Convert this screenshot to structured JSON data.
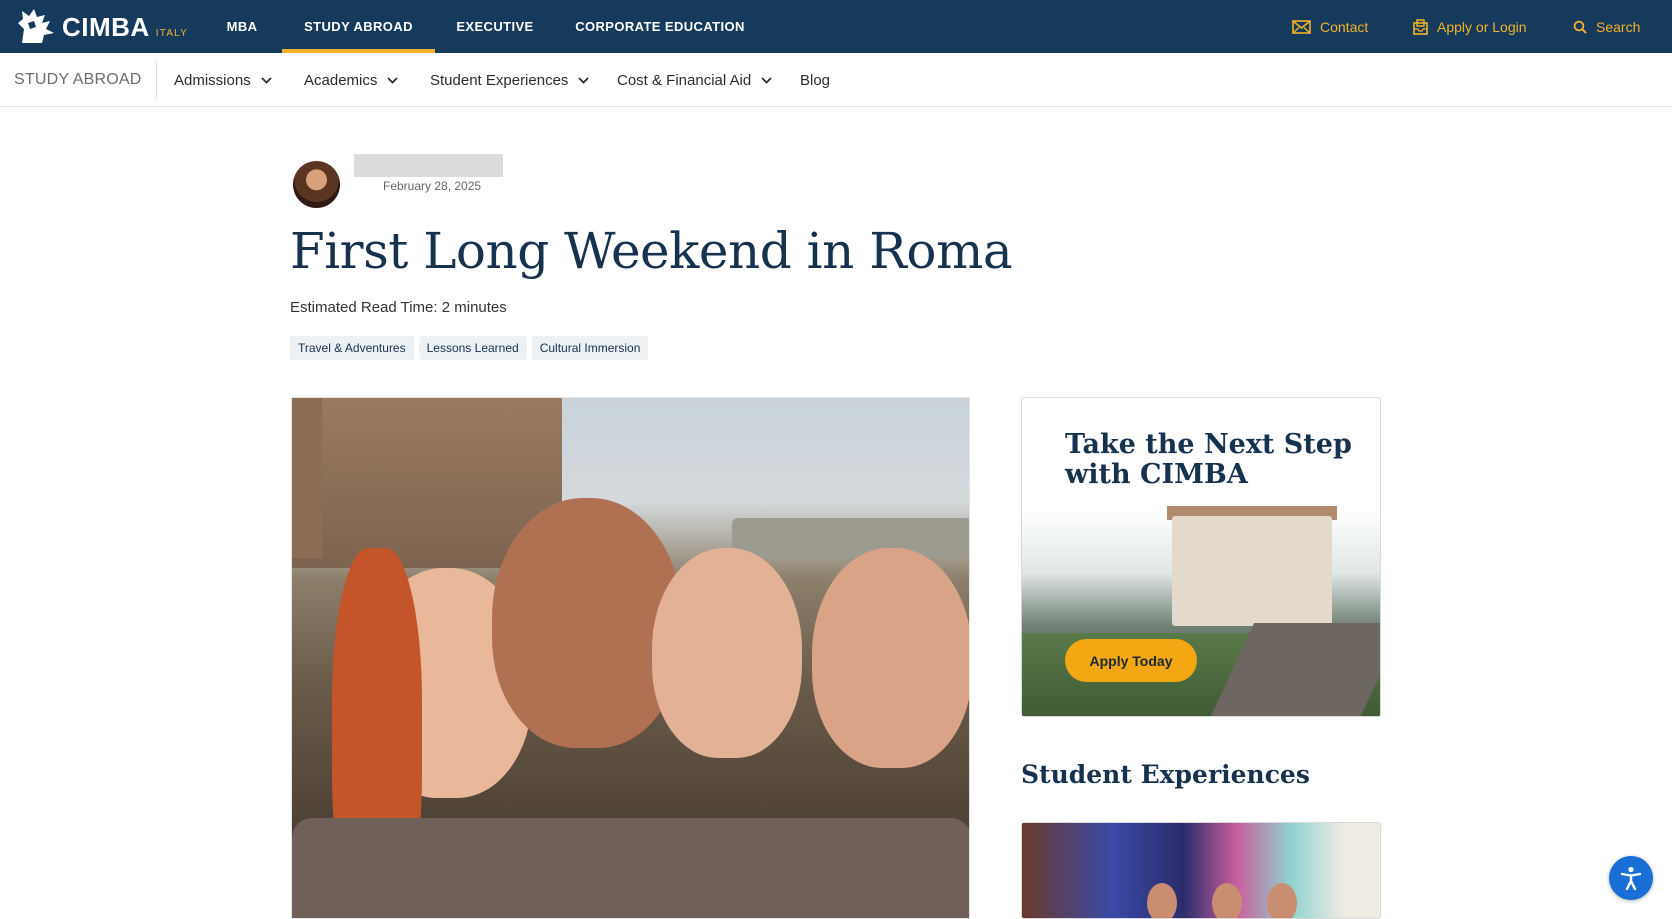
{
  "brand": {
    "name": "CIMBA",
    "country": "ITALY"
  },
  "main_nav": {
    "items": [
      {
        "label": "MBA",
        "active": false
      },
      {
        "label": "STUDY ABROAD",
        "active": true
      },
      {
        "label": "EXECUTIVE",
        "active": false
      },
      {
        "label": "CORPORATE EDUCATION",
        "active": false
      }
    ]
  },
  "utility_nav": {
    "contact": "Contact",
    "apply_login": "Apply or Login",
    "search": "Search"
  },
  "sub_nav": {
    "section_title": "STUDY ABROAD",
    "items": [
      {
        "label": "Admissions",
        "dropdown": true
      },
      {
        "label": "Academics",
        "dropdown": true
      },
      {
        "label": "Student Experiences",
        "dropdown": true
      },
      {
        "label": "Cost & Financial Aid",
        "dropdown": true
      },
      {
        "label": "Blog",
        "dropdown": false
      }
    ]
  },
  "article": {
    "date": "February 28, 2025",
    "title": "First Long Weekend in Roma",
    "read_time": "Estimated Read Time: 2 minutes",
    "tags": [
      "Travel & Adventures",
      "Lessons Learned",
      "Cultural Immersion"
    ]
  },
  "sidebar": {
    "cta_heading": "Take the Next Step with CIMBA",
    "cta_button": "Apply Today",
    "section_heading": "Student Experiences"
  },
  "colors": {
    "navy": "#163a5c",
    "gold": "#f3b229",
    "cta_orange": "#f3a712",
    "accessibility_blue": "#1a6fd6"
  },
  "icons": {
    "contact": "envelope-icon",
    "apply": "inbox-icon",
    "search": "search-icon",
    "dropdown": "chevron-down-icon",
    "accessibility": "accessibility-icon"
  }
}
